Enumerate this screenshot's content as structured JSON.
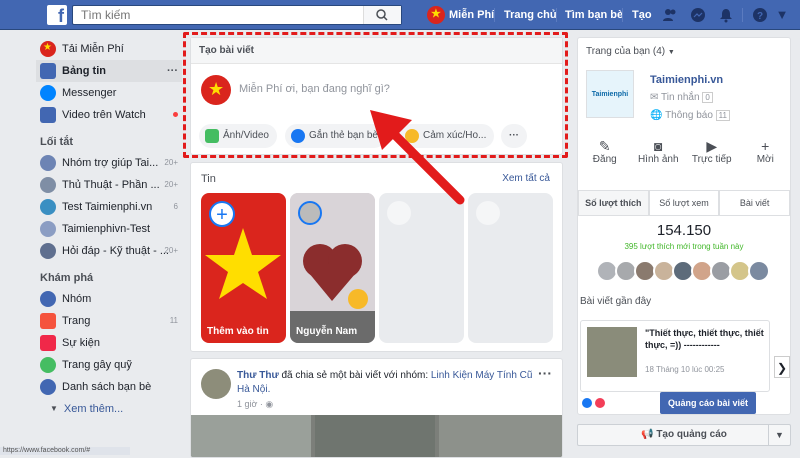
{
  "topbar": {
    "logo": "f",
    "search_placeholder": "Tìm kiếm",
    "profile_name": "Miễn Phí",
    "home": "Trang chủ",
    "find_friends": "Tìm bạn bè",
    "create": "Tạo"
  },
  "left": {
    "profile": "Tải Miễn Phí",
    "items": [
      {
        "label": "Bảng tin",
        "color": "#4267b2"
      },
      {
        "label": "Messenger",
        "color": "#0084ff"
      },
      {
        "label": "Video trên Watch",
        "color": "#4267b2"
      }
    ],
    "shortcuts_heading": "Lối tắt",
    "shortcuts": [
      {
        "label": "Nhóm trợ giúp Tai...",
        "count": "20+"
      },
      {
        "label": "Thủ Thuật - Phần ...",
        "count": "20+"
      },
      {
        "label": "Test Taimienphi.vn",
        "count": "6"
      },
      {
        "label": "Taimienphivn-Test",
        "count": ""
      },
      {
        "label": "Hỏi đáp - Kỹ thuật - ...",
        "count": "20+"
      }
    ],
    "explore_heading": "Khám phá",
    "explore": [
      {
        "label": "Nhóm",
        "count": "",
        "color": "#4267b2"
      },
      {
        "label": "Trang",
        "count": "11",
        "color": "#f5533d"
      },
      {
        "label": "Sự kiện",
        "count": "",
        "color": "#f02849"
      },
      {
        "label": "Trang gây quỹ",
        "count": "",
        "color": "#45bd62"
      },
      {
        "label": "Danh sách bạn bè",
        "count": "",
        "color": "#4267b2"
      }
    ],
    "see_more": "Xem thêm..."
  },
  "composer": {
    "title": "Tạo bài viết",
    "placeholder": "Miễn Phí ơi, bạn đang nghĩ gì?",
    "photo": "Ảnh/Video",
    "tag": "Gắn thẻ bạn bè",
    "feeling": "Cảm xúc/Ho...",
    "more": "···"
  },
  "stories": {
    "heading": "Tin",
    "see_all": "Xem tất cả",
    "add_label": "Thêm vào tin",
    "friend_label": "Nguyễn Nam"
  },
  "post": {
    "author": "Thư Thư",
    "action": "đã chia sẻ một bài viết với nhóm:",
    "group": "Linh Kiện Máy Tính Cũ Hà Nội.",
    "time": "1 giờ",
    "more": "···"
  },
  "right": {
    "pages_heading": "Trang của bạn (4)",
    "page_name": "Taimienphi.vn",
    "page_logo_text": "Taimienphi",
    "messages": "Tin nhắn",
    "messages_count": "0",
    "notifications": "Thông báo",
    "notifications_count": "11",
    "actions": [
      "Đăng",
      "Hình ảnh",
      "Trực tiếp",
      "Mời"
    ],
    "tabs": [
      "Số lượt thích",
      "Số lượt xem",
      "Bài viết"
    ],
    "likes_count": "154.150",
    "new_likes": "395 lượt thích mới trong tuần này",
    "recent_heading": "Bài viết gần đây",
    "recent_title": "\"Thiết thực, thiết thực, thiết thực, =)) ------------",
    "recent_date": "18 Tháng 10 lúc 00:25",
    "promote": "Quảng cáo bài viết",
    "create_ad": "Tạo quảng cáo"
  },
  "statusbar": "https://www.facebook.com/#"
}
